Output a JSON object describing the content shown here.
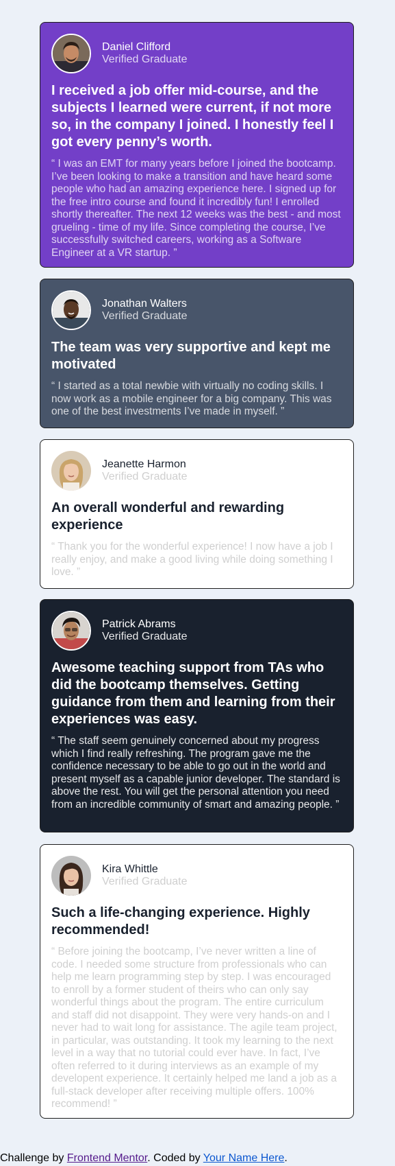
{
  "colors": {
    "page_background": "#ecf1f8",
    "card_purple": "#733fc8",
    "card_slate": "#48556a",
    "card_white": "#ffffff",
    "card_dark": "#19212e"
  },
  "testimonials": [
    {
      "theme": "purple",
      "name": "Daniel Clifford",
      "role": "Verified Graduate",
      "avatar_icon": "avatar-daniel-clifford",
      "headline": "I received a job offer mid-course, and the subjects I learned were current, if not more so, in the company I joined. I honestly feel I got every penny’s worth.",
      "quote": "“ I was an EMT for many years before I joined the bootcamp. I’ve been looking to make a transition and have heard some people who had an amazing experience here. I signed up for the free intro course and found it incredibly fun! I enrolled shortly thereafter. The next 12 weeks was the best - and most grueling - time of my life. Since completing the course, I’ve successfully switched careers, working as a Software Engineer at a VR startup. ”"
    },
    {
      "theme": "slate",
      "name": "Jonathan Walters",
      "role": "Verified Graduate",
      "avatar_icon": "avatar-jonathan-walters",
      "headline": "The team was very supportive and kept me motivated",
      "quote": "“ I started as a total newbie with virtually no coding skills. I now work as a mobile engineer for a big company. This was one of the best investments I’ve made in myself. ”"
    },
    {
      "theme": "white",
      "name": "Jeanette Harmon",
      "role": "Verified Graduate",
      "avatar_icon": "avatar-jeanette-harmon",
      "headline": "An overall wonderful and rewarding experience",
      "quote": "“ Thank you for the wonderful experience! I now have a job I really enjoy, and make a good living while doing something I love. ”"
    },
    {
      "theme": "dark",
      "name": "Patrick Abrams",
      "role": "Verified Graduate",
      "avatar_icon": "avatar-patrick-abrams",
      "headline": "Awesome teaching support from TAs who did the bootcamp themselves. Getting guidance from them and learning from their experiences was easy.",
      "quote": "“ The staff seem genuinely concerned about my progress which I find really refreshing. The program gave me the confidence necessary to be able to go out in the world and present myself as a capable junior developer. The standard is above the rest. You will get the personal attention you need from an incredible community of smart and amazing people. ”"
    },
    {
      "theme": "white",
      "name": "Kira Whittle",
      "role": "Verified Graduate",
      "avatar_icon": "avatar-kira-whittle",
      "headline": "Such a life-changing experience. Highly recommended!",
      "quote": "“ Before joining the bootcamp, I’ve never written a line of code. I needed some structure from professionals who can help me learn programming step by step. I was encouraged to enroll by a former student of theirs who can only say wonderful things about the program. The entire curriculum and staff did not disappoint. They were very hands-on and I never had to wait long for assistance. The agile team project, in particular, was outstanding. It took my learning to the next level in a way that no tutorial could ever have. In fact, I’ve often referred to it during interviews as an example of my developent experience. It certainly helped me land a job as a full-stack developer after receiving multiple offers. 100% recommend! ”"
    }
  ],
  "attribution": {
    "prefix": "Challenge by ",
    "frontend_mentor": "Frontend Mentor",
    "middle": ". Coded by ",
    "your_name": "Your Name Here",
    "suffix": "."
  }
}
